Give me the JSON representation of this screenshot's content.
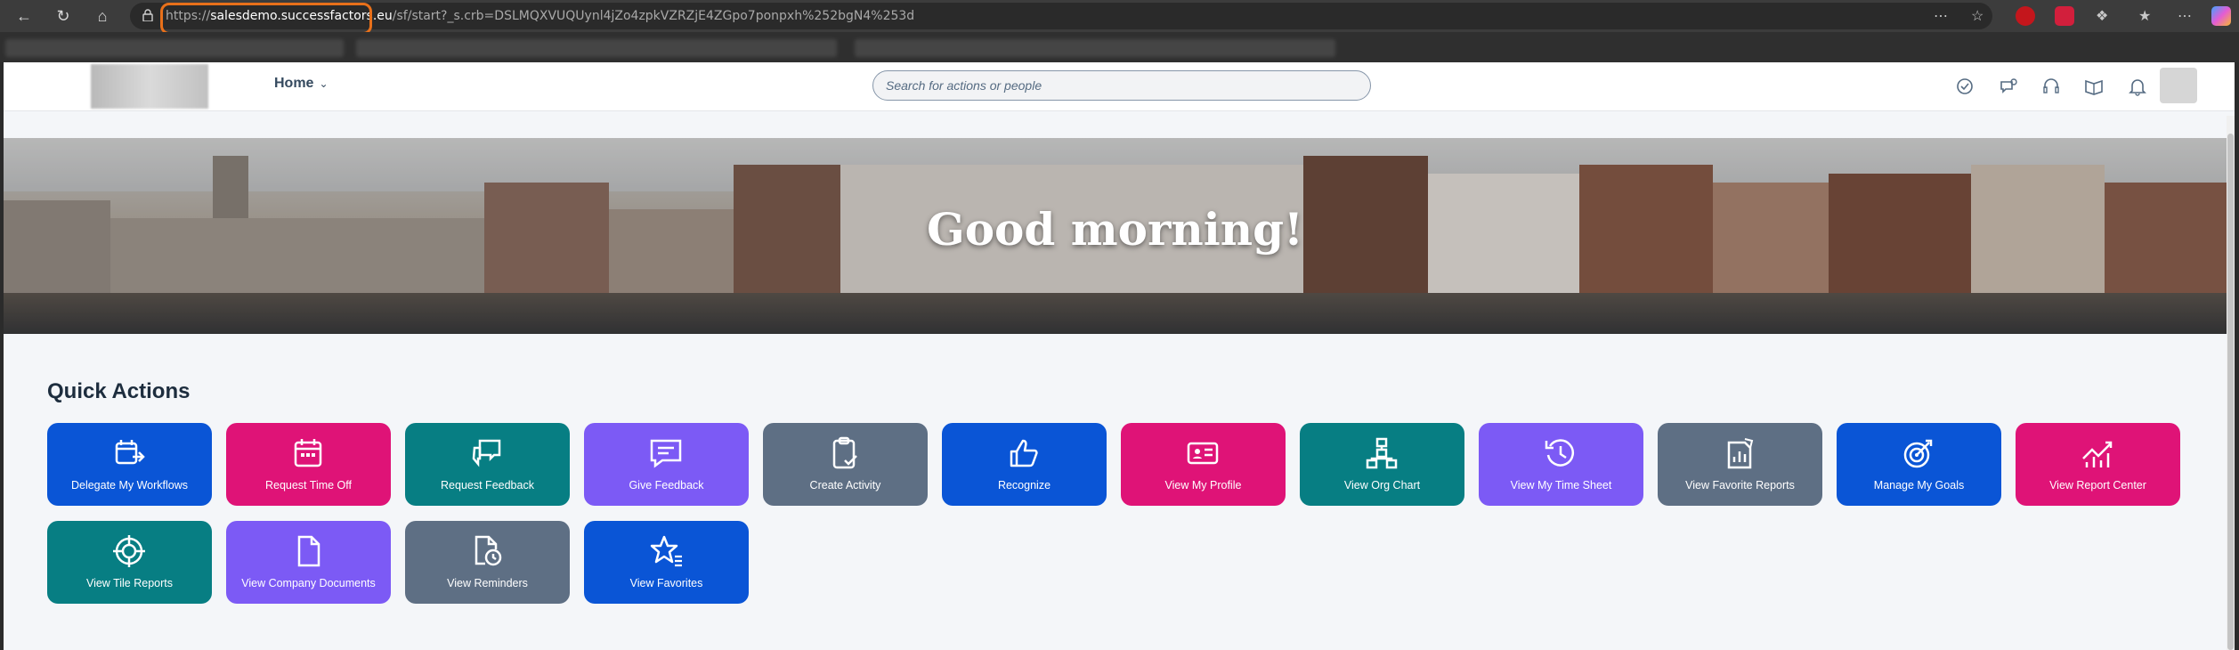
{
  "browser": {
    "url_prefix": "https://",
    "url_domain": "salesdemo.successfactors.eu",
    "url_rest": "/sf/start?_s.crb=DSLMQXVUQUynl4jZo4zpkVZRZjE4ZGpo7ponpxh%252bgN4%253d"
  },
  "shell": {
    "home_label": "Home",
    "search_placeholder": "Search for actions or people"
  },
  "hero": {
    "greeting": "Good morning!"
  },
  "quick_actions": {
    "title": "Quick Actions",
    "tiles": [
      {
        "label": "Delegate My Workflows",
        "icon": "delegate-icon",
        "color": "#0a55d6"
      },
      {
        "label": "Request Time Off",
        "icon": "calendar-icon",
        "color": "#df1377"
      },
      {
        "label": "Request Feedback",
        "icon": "chat-bubbles-icon",
        "color": "#077e83"
      },
      {
        "label": "Give Feedback",
        "icon": "comment-icon",
        "color": "#7c5af5"
      },
      {
        "label": "Create Activity",
        "icon": "clipboard-check-icon",
        "color": "#5e6f84"
      },
      {
        "label": "Recognize",
        "icon": "thumbs-up-icon",
        "color": "#0a55d6"
      },
      {
        "label": "View My Profile",
        "icon": "id-card-icon",
        "color": "#df1377"
      },
      {
        "label": "View Org Chart",
        "icon": "org-chart-icon",
        "color": "#077e83"
      },
      {
        "label": "View My Time Sheet",
        "icon": "history-icon",
        "color": "#7c5af5"
      },
      {
        "label": "View Favorite Reports",
        "icon": "report-icon",
        "color": "#5e6f84"
      },
      {
        "label": "Manage My Goals",
        "icon": "target-icon",
        "color": "#0a55d6"
      },
      {
        "label": "View Report Center",
        "icon": "trend-chart-icon",
        "color": "#df1377"
      },
      {
        "label": "View Tile Reports",
        "icon": "crosshair-icon",
        "color": "#077e83"
      },
      {
        "label": "View Company Documents",
        "icon": "document-icon",
        "color": "#7c5af5"
      },
      {
        "label": "View Reminders",
        "icon": "document-clock-icon",
        "color": "#5e6f84"
      },
      {
        "label": "View Favorites",
        "icon": "star-icon",
        "color": "#0a55d6"
      }
    ]
  }
}
